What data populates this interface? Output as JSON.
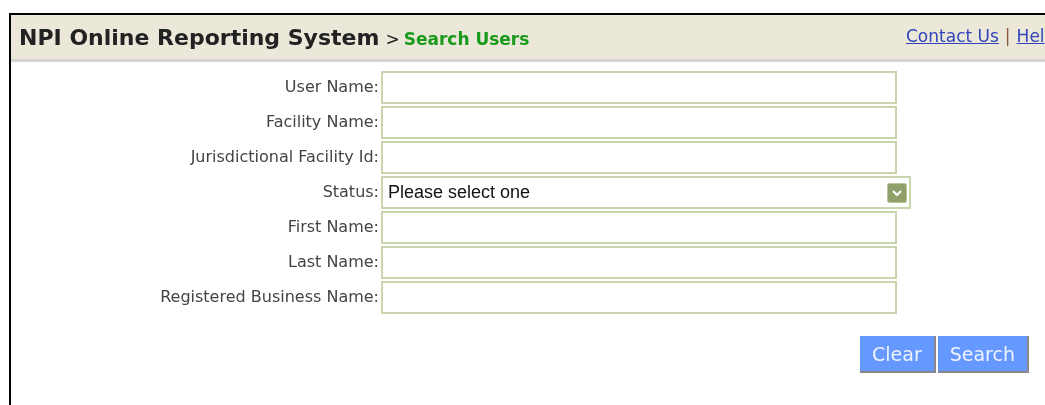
{
  "header": {
    "title": "NPI Online Reporting System",
    "separator": ">",
    "subtitle": "Search Users",
    "links": [
      {
        "label": "Contact Us"
      },
      {
        "label": "Hel"
      }
    ],
    "link_divider": "|"
  },
  "form": {
    "fields": [
      {
        "label": "User Name:",
        "kind": "text"
      },
      {
        "label": "Facility Name:",
        "kind": "text"
      },
      {
        "label": "Jurisdictional Facility Id:",
        "kind": "text"
      },
      {
        "label": "Status:",
        "kind": "select",
        "value": "Please select one"
      },
      {
        "label": "First Name:",
        "kind": "text"
      },
      {
        "label": "Last Name:",
        "kind": "text"
      },
      {
        "label": "Registered Business Name:",
        "kind": "text"
      }
    ]
  },
  "buttons": [
    {
      "label": "Clear"
    },
    {
      "label": "Search"
    }
  ]
}
